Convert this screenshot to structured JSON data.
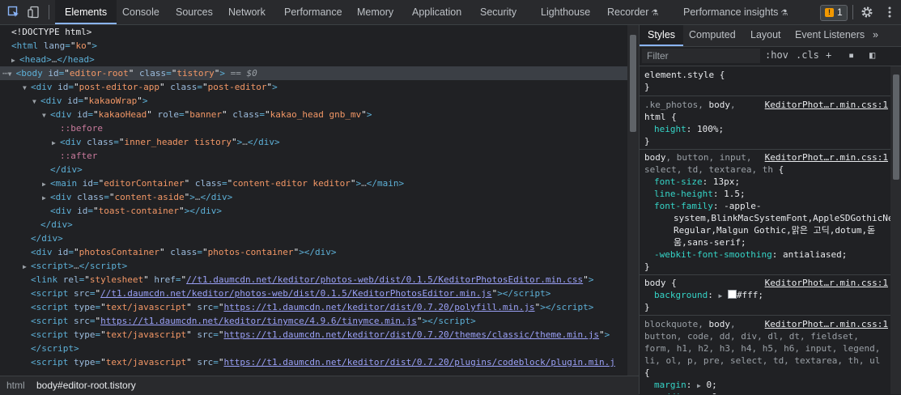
{
  "tabs": [
    "Elements",
    "Console",
    "Sources",
    "Network",
    "Performance",
    "Memory",
    "Application",
    "Security",
    "Lighthouse",
    "Recorder",
    "Performance insights"
  ],
  "issues_count": "1",
  "dom": {
    "selected_suffix": "== $0"
  },
  "breadcrumbs": [
    "html",
    "body#editor-root.tistory"
  ],
  "side_tabs": [
    "Styles",
    "Computed",
    "Layout",
    "Event Listeners"
  ],
  "filter_placeholder": "Filter",
  "filter_tools": [
    ":hov",
    ".cls",
    "+"
  ],
  "colors": {
    "accent": "#8ab4f8",
    "tag": "#5db0d7",
    "attr": "#9bbbdc",
    "value": "#f29766",
    "prop": "#35d4c7"
  }
}
